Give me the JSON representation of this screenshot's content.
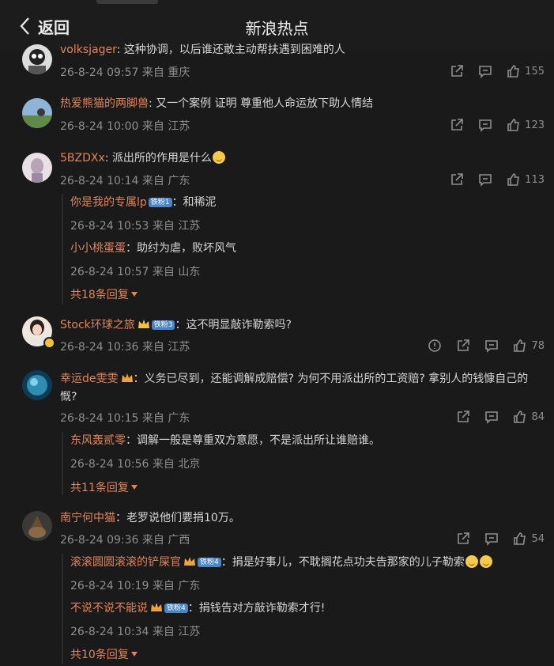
{
  "header": {
    "back_label": "返回",
    "title": "新浪热点"
  },
  "comments": [
    {
      "user": "volksjager",
      "sep": ": ",
      "text": "这种协调，以后谁还敢主动帮扶遇到困难的人",
      "time": "26-8-24 09:57",
      "from": "来自 重庆",
      "likes": "155"
    },
    {
      "user": "热爱熊猫的两脚兽",
      "sep": ": ",
      "text": "又一个案例 证明 尊重他人命运放下助人情结",
      "time": "26-8-24 10:00",
      "from": "来自 江苏",
      "likes": "123"
    },
    {
      "user": "5BZDXx",
      "sep": ": ",
      "text": "派出所的作用是什么",
      "time": "26-8-24 10:14",
      "from": "来自 广东",
      "likes": "113",
      "replies": [
        {
          "user": "你是我的专属lp",
          "badge": "铁粉1",
          "sep": "：",
          "text": "和稀泥",
          "time": "26-8-24 10:53",
          "from": "来自 江苏"
        },
        {
          "user": "小小桃蛋蛋",
          "sep": "：",
          "text": "助纣为虐，败坏风气",
          "time": "26-8-24 10:57",
          "from": "来自 山东"
        }
      ],
      "more": "共18条回复"
    },
    {
      "user": "Stock环球之旅",
      "badge": "铁粉3",
      "sep": "：",
      "text": "这不明显敲诈勒索吗?",
      "time": "26-8-24 10:36",
      "from": "来自 江苏",
      "likes": "78"
    },
    {
      "user": "幸运de雯雯",
      "sep": "：",
      "text": "义务已尽到，还能调解成赔偿? 为何不用派出所的工资赔? 拿别人的钱慷自己的慨?",
      "time": "26-8-24 10:15",
      "from": "来自 广东",
      "likes": "84",
      "replies": [
        {
          "user": "东风轰贰零",
          "sep": "：",
          "text": "调解一般是尊重双方意愿，不是派出所让谁赔谁。",
          "time": "26-8-24 10:56",
          "from": "来自 北京"
        }
      ],
      "more": "共11条回复"
    },
    {
      "user": "南宁何中猫",
      "sep": "：",
      "text": "老罗说他们要捐10万。",
      "time": "26-8-24 09:36",
      "from": "来自 广西",
      "likes": "54",
      "replies": [
        {
          "user": "滚滚圆圆滚滚的铲屎官",
          "badge": "铁粉4",
          "sep": "：",
          "text": "捐是好事儿，不耽搁花点功夫告那家的儿子勒索",
          "time": "26-8-24 10:19",
          "from": "来自 广东"
        },
        {
          "user": "不说不说不能说",
          "badge": "铁粉4",
          "sep": "：",
          "text": "捐钱告对方敲诈勒索才行!",
          "time": "26-8-24 10:34",
          "from": "来自 江苏"
        }
      ],
      "more": "共10条回复"
    }
  ],
  "colors": {
    "accent": "#e0855a",
    "background": "#1a1a1a",
    "meta": "#8e8e8e"
  },
  "icons": [
    "chevron-left-icon",
    "share-icon",
    "comment-icon",
    "like-icon",
    "report-icon"
  ]
}
